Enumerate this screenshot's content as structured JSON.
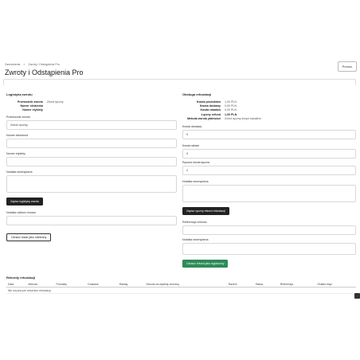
{
  "breadcrumb": [
    "Zamówienia",
    ">",
    "Zwroty i Odstąpienia Pro"
  ],
  "page_title": "Zwroty i Odstąpienia Pro",
  "help_label": "Pomoc",
  "logistics": {
    "title": "Logistyka zwrotu",
    "rows": [
      {
        "k": "Przewoźnik zwrotu",
        "v": "Zwrot ręczny"
      },
      {
        "k": "Numer śledzenia",
        "v": ""
      },
      {
        "k": "Numer etykiety",
        "v": ""
      }
    ],
    "carrier_label": "Przewoźnik zwrotu",
    "carrier_value": "Zwrot ręczny",
    "tracking_label": "Numer śledzenia",
    "tracking_value": "",
    "label_no_label": "Numer etykiety",
    "label_no_value": "",
    "internal_note_label": "Notatka wewnętrzna",
    "save_button": "Zapisz logistykę zwrotu",
    "receipt_note_label": "Notatka odbioru towaru",
    "mark_received_button": "Oznacz towar jako odebrany"
  },
  "refund": {
    "title": "Obsługa refundacji",
    "rows": [
      {
        "k": "Kwota produktów",
        "v": "1,00 PLN"
      },
      {
        "k": "Kwota dostawy",
        "v": "0,00 PLN"
      },
      {
        "k": "Kwota rabatów",
        "v": "0,00 PLN"
      },
      {
        "k": "Łączny refund",
        "v": "1,00 PLN"
      },
      {
        "k": "Metoda zwrotu płatności",
        "v": "Zwrot ręczny innym kanałem"
      }
    ],
    "shipping_label": "Kwota dostawy",
    "shipping_value": "0",
    "discount_label": "Kwota rabatu",
    "discount_value": "0",
    "manual_total_label": "Ręczna kwota łączna",
    "manual_total_value": "2",
    "internal_note_label": "Notatka wewnętrzna",
    "save_manual_button": "Zapisz ręczny rekord refundacji",
    "reference_label": "Referencja refundu",
    "reference_value": "",
    "internal_note2_label": "Notatka wewnętrzna",
    "mark_completed_button": "Oznacz refund jako wypłacony"
  },
  "refunds_table": {
    "title": "Rekordy refundacji",
    "columns": [
      "Data",
      "Metoda",
      "Produkty",
      "Dostawa",
      "Rabaty",
      "Szkoda za etykietę zwrotną",
      "Razem",
      "Status",
      "Referencja",
      "Ostatni błąd"
    ],
    "empty_text": "Nie ma jeszcze rekordów refundacji."
  }
}
